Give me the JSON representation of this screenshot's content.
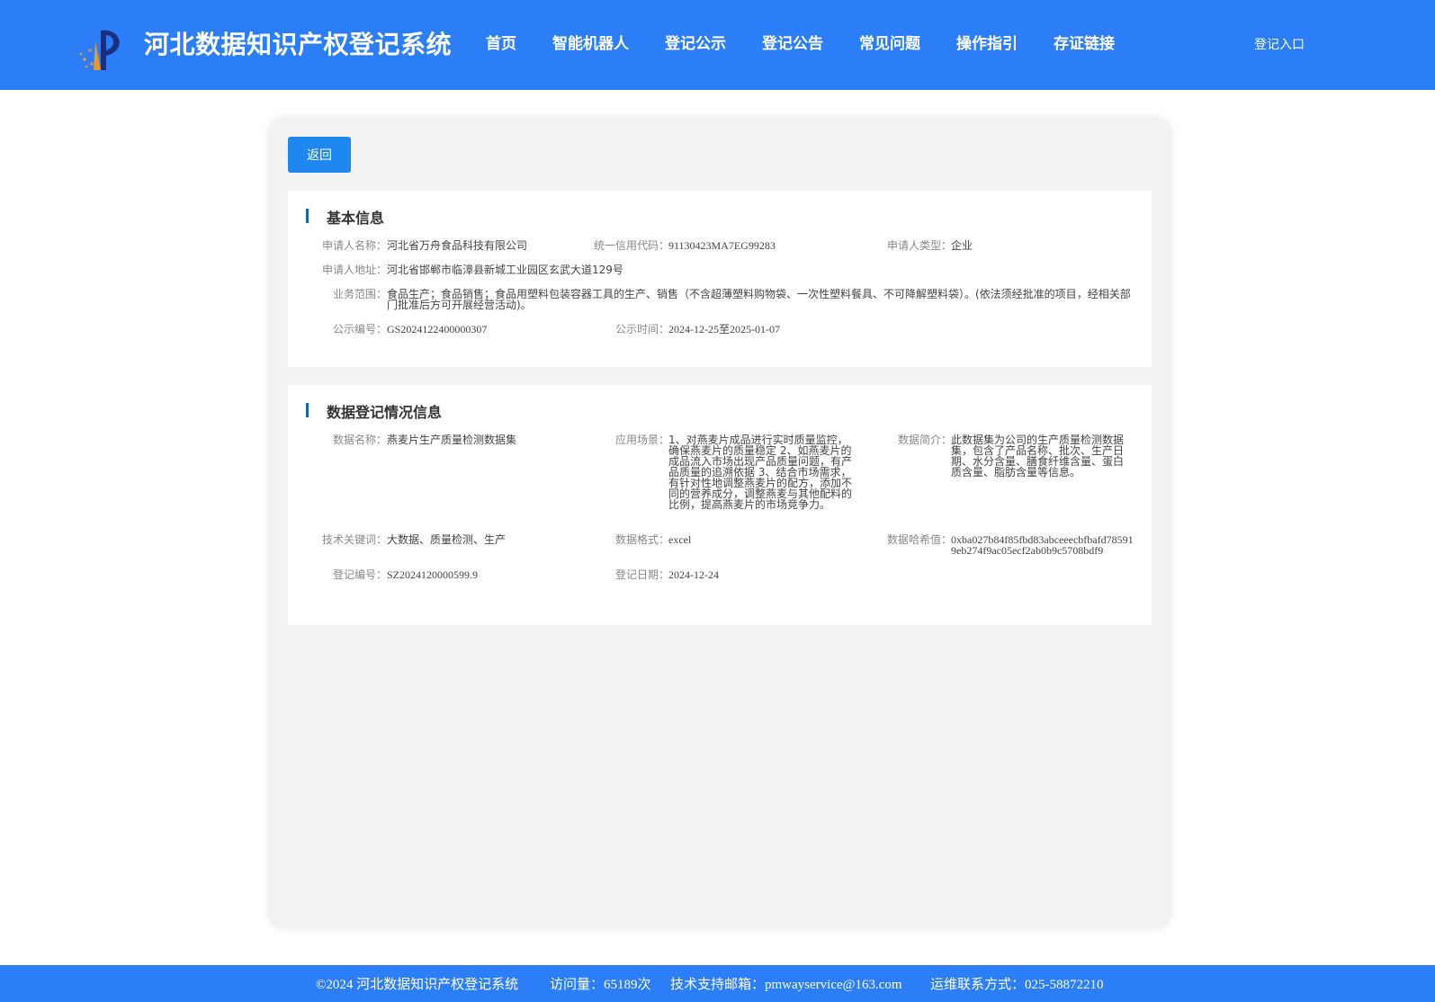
{
  "header": {
    "title": "河北数据知识产权登记系统",
    "login": "登记入口",
    "nav": [
      "首页",
      "智能机器人",
      "登记公示",
      "登记公告",
      "常见问题",
      "操作指引",
      "存证链接"
    ]
  },
  "page": {
    "back": "返回"
  },
  "basic": {
    "title": "基本信息",
    "applicant_name_label": "申请人名称：",
    "applicant_name": "河北省万舟食品科技有限公司",
    "credit_code_label": "统一信用代码：",
    "credit_code": "91130423MA7EG99283",
    "applicant_type_label": "申请人类型：",
    "applicant_type": "企业",
    "address_label": "申请人地址：",
    "address": "河北省邯郸市临漳县新城工业园区玄武大道129号",
    "scope_label": "业务范围：",
    "scope": "食品生产；食品销售；食品用塑料包装容器工具的生产、销售（不含超薄塑料购物袋、一次性塑料餐具、不可降解塑料袋）。(依法须经批准的项目，经相关部门批准后方可开展经营活动)。",
    "notice_no_label": "公示编号：",
    "notice_no": "GS2024122400000307",
    "notice_time_label": "公示时间：",
    "notice_time": "2024-12-25至2025-01-07"
  },
  "registration": {
    "title": "数据登记情况信息",
    "data_name_label": "数据名称：",
    "data_name": "燕麦片生产质量检测数据集",
    "scenario_label": "应用场景：",
    "scenario": "1、对燕麦片成品进行实时质量监控，确保燕麦片的质量稳定 2、如燕麦片的成品流入市场出现产品质量问题，有产品质量的追溯依据 3、结合市场需求，有针对性地调整燕麦片的配方，添加不同的营养成分，调整燕麦与其他配料的比例，提高燕麦片的市场竞争力。",
    "intro_label": "数据简介：",
    "intro": "此数据集为公司的生产质量检测数据集，包含了产品名称、批次、生产日期、水分含量、膳食纤维含量、蛋白质含量、脂肪含量等信息。",
    "keywords_label": "技术关键词：",
    "keywords": "大数据、质量检测、生产",
    "format_label": "数据格式：",
    "format": "excel",
    "hash_label": "数据哈希值：",
    "hash": "0xba027b84f85fbd83abceeecbfbafd785919eb274f9ac05ecf2ab0b9c5708bdf9",
    "reg_no_label": "登记编号：",
    "reg_no": "SZ2024120000599.9",
    "reg_date_label": "登记日期：",
    "reg_date": "2024-12-24"
  },
  "footer": {
    "copyright": "©2024 河北数据知识产权登记系统",
    "visits": "访问量：65189次",
    "email": "技术支持邮箱：pmwayservice@163.com",
    "ops": "运维联系方式：025-58872210"
  }
}
